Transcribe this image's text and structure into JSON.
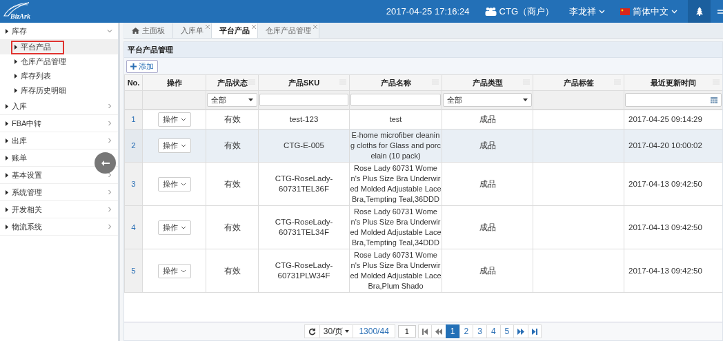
{
  "header": {
    "logo": "BizArk",
    "datetime": "2017-04-25 17:16:24",
    "account": "CTG（商户）",
    "user": "李龙祥",
    "language": "简体中文"
  },
  "sidebar": {
    "items": [
      {
        "label": "库存",
        "expanded": true,
        "children": [
          {
            "label": "平台产品",
            "selected": true
          },
          {
            "label": "仓库产品管理",
            "selected": false
          },
          {
            "label": "库存列表",
            "selected": false
          },
          {
            "label": "库存历史明细",
            "selected": false
          }
        ]
      },
      {
        "label": "入库",
        "expanded": false
      },
      {
        "label": "FBA中转",
        "expanded": false
      },
      {
        "label": "出库",
        "expanded": false
      },
      {
        "label": "账单",
        "expanded": false
      },
      {
        "label": "基本设置",
        "expanded": false
      },
      {
        "label": "系统管理",
        "expanded": false
      },
      {
        "label": "开发相关",
        "expanded": false
      },
      {
        "label": "物流系统",
        "expanded": false
      }
    ]
  },
  "tabs": [
    {
      "label": "主面板",
      "kind": "home",
      "selected": false
    },
    {
      "label": "入库单",
      "kind": "closable",
      "selected": false
    },
    {
      "label": "平台产品",
      "kind": "closable",
      "selected": true
    },
    {
      "label": "仓库产品管理",
      "kind": "closable",
      "selected": false
    }
  ],
  "panel": {
    "title": "平台产品管理",
    "add_button": "添加"
  },
  "table": {
    "columns": [
      {
        "label": "No.",
        "menu": false
      },
      {
        "label": "操作",
        "menu": false
      },
      {
        "label": "产品状态",
        "menu": true
      },
      {
        "label": "产品SKU",
        "menu": true
      },
      {
        "label": "产品名称",
        "menu": true
      },
      {
        "label": "产品类型",
        "menu": true
      },
      {
        "label": "产品标签",
        "menu": true
      },
      {
        "label": "最近更新时间",
        "menu": true
      }
    ],
    "filters": [
      {
        "kind": "none"
      },
      {
        "kind": "none"
      },
      {
        "kind": "select",
        "value": "全部"
      },
      {
        "kind": "text"
      },
      {
        "kind": "text"
      },
      {
        "kind": "select",
        "value": "全部"
      },
      {
        "kind": "none"
      },
      {
        "kind": "date"
      }
    ],
    "rows": [
      {
        "no": "1",
        "action": "操作",
        "status": "有效",
        "sku": "test-123",
        "name": "test",
        "type": "成品",
        "updated": "2017-04-25 09:14:29",
        "selected": false
      },
      {
        "no": "2",
        "action": "操作",
        "status": "有效",
        "sku": "CTG-E-005",
        "name": "E-home microfiber cleaning cloths for Glass and porcelain (10 pack)",
        "type": "成品",
        "updated": "2017-04-20 10:00:02",
        "selected": true
      },
      {
        "no": "3",
        "action": "操作",
        "status": "有效",
        "sku": "CTG-RoseLady-60731TEL36F",
        "name": "Rose Lady 60731 Women's Plus Size Bra Underwired Molded Adjustable Lace Bra,Tempting Teal,36DDD",
        "type": "成品",
        "updated": "2017-04-13 09:42:50",
        "selected": false
      },
      {
        "no": "4",
        "action": "操作",
        "status": "有效",
        "sku": "CTG-RoseLady-60731TEL34F",
        "name": "Rose Lady 60731 Women's Plus Size Bra Underwired Molded Adjustable Lace Bra,Tempting Teal,34DDD",
        "type": "成品",
        "updated": "2017-04-13 09:42:50",
        "selected": false
      },
      {
        "no": "5",
        "action": "操作",
        "status": "有效",
        "sku": "CTG-RoseLady-60731PLW34F",
        "name": "Rose Lady 60731 Women's Plus Size Bra Underwired Molded Adjustable Lace Bra,Plum Shado",
        "type": "成品",
        "updated": "2017-04-13 09:42:50",
        "selected": false
      }
    ]
  },
  "pager": {
    "page_size": "30/页",
    "total": "1300/44",
    "page_input": "1",
    "pages": [
      {
        "label": "1",
        "selected": true
      },
      {
        "label": "2",
        "selected": false
      },
      {
        "label": "3",
        "selected": false
      },
      {
        "label": "4",
        "selected": false
      },
      {
        "label": "5",
        "selected": false
      }
    ]
  }
}
